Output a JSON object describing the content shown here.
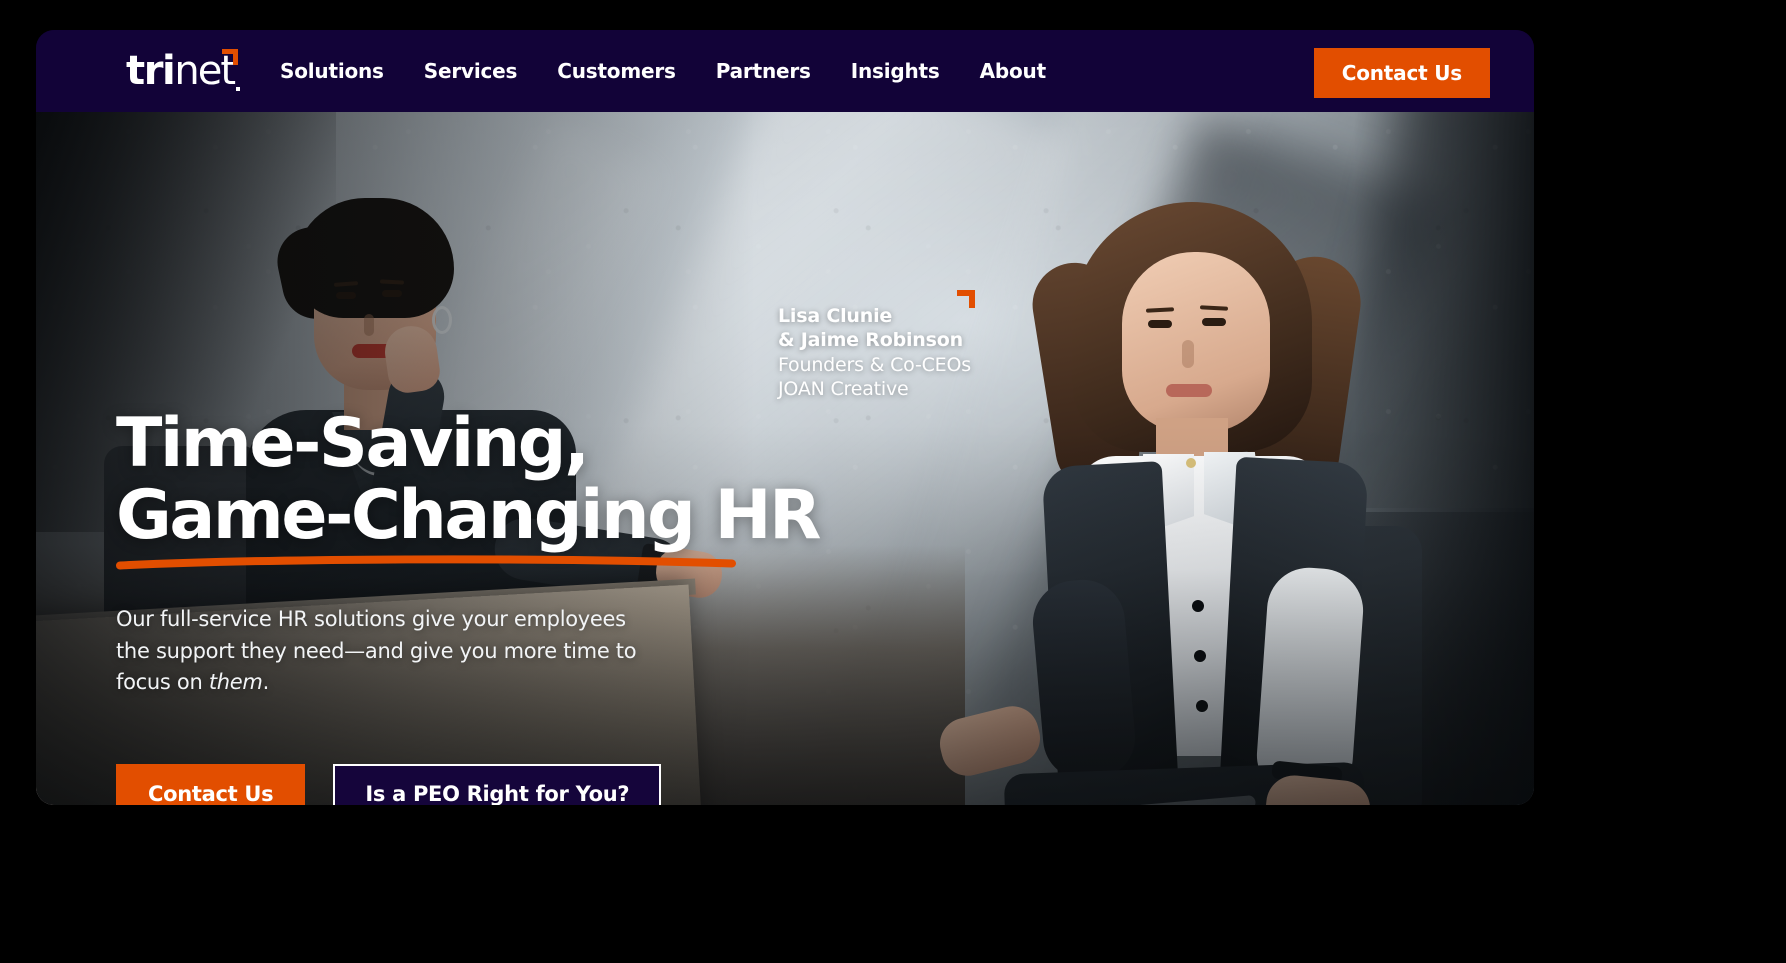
{
  "brand": {
    "logo_text_bold": "tri",
    "logo_text_light": "net",
    "accent_color": "#E24E00",
    "navy_color": "#120338"
  },
  "header": {
    "nav_items": [
      {
        "label": "Solutions"
      },
      {
        "label": "Services"
      },
      {
        "label": "Customers"
      },
      {
        "label": "Partners"
      },
      {
        "label": "Insights"
      },
      {
        "label": "About"
      }
    ],
    "cta_label": "Contact Us"
  },
  "hero": {
    "attribution": {
      "name_line_1": "Lisa Clunie",
      "name_line_2": "& Jaime Robinson",
      "role": "Founders & Co-CEOs",
      "company": "JOAN Creative"
    },
    "headline_line_1": "Time-Saving,",
    "headline_line_2": "Game-Changing HR",
    "subhead_before_em": "Our full-service HR solutions give your employees the support they need—and give you more time to focus on ",
    "subhead_em": "them",
    "subhead_after_em": ".",
    "primary_cta": "Contact Us",
    "secondary_cta": "Is a PEO Right for You?"
  }
}
